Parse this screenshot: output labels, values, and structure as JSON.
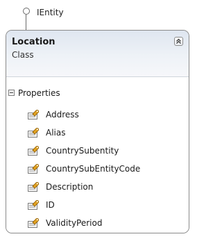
{
  "interface": {
    "name": "IEntity"
  },
  "class": {
    "name": "Location",
    "kind": "Class"
  },
  "sections": [
    {
      "title": "Properties",
      "items": [
        {
          "label": "Address",
          "icon": "property-icon"
        },
        {
          "label": "Alias",
          "icon": "property-icon"
        },
        {
          "label": "CountrySubentity",
          "icon": "property-icon"
        },
        {
          "label": "CountrySubEntityCode",
          "icon": "property-icon"
        },
        {
          "label": "Description",
          "icon": "property-icon"
        },
        {
          "label": "ID",
          "icon": "property-icon"
        },
        {
          "label": "ValidityPeriod",
          "icon": "property-icon"
        }
      ]
    }
  ],
  "colors": {
    "header_gradient_top": "#dfe6f0",
    "border": "#8a8a8a",
    "icon_accent": "#e0a020"
  }
}
